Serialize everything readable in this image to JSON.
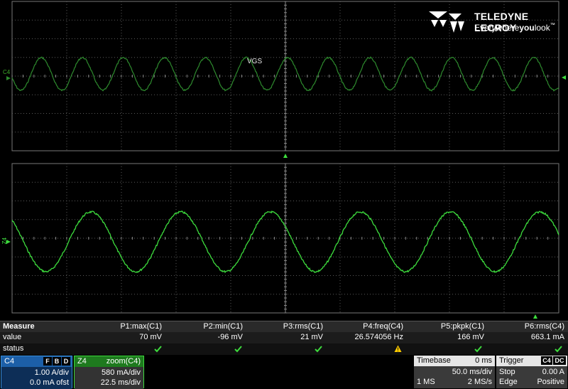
{
  "brand": {
    "name": "TELEDYNE LECROY",
    "tagline_prefix": "Everywhere",
    "tagline_bold": "you",
    "tagline_suffix": "look",
    "tm": "™"
  },
  "screen": {
    "channel_top": "C4",
    "channel_bottom": "Z4",
    "trace_label": "VGS",
    "colors": {
      "c4": "#2e8b2e",
      "z4": "#3ddc3d",
      "grid": "#5a5a5a"
    }
  },
  "measure": {
    "row_labels": {
      "header": "Measure",
      "value": "value",
      "status": "status"
    },
    "params": [
      {
        "name": "P1:max(C1)",
        "value": "70 mV",
        "status": "ok"
      },
      {
        "name": "P2:min(C1)",
        "value": "-96 mV",
        "status": "ok"
      },
      {
        "name": "P3:rms(C1)",
        "value": "21 mV",
        "status": "ok"
      },
      {
        "name": "P4:freq(C4)",
        "value": "26.574056 Hz",
        "status": "warning"
      },
      {
        "name": "P5:pkpk(C1)",
        "value": "166 mV",
        "status": "ok"
      },
      {
        "name": "P6:rms(C4)",
        "value": "663.1 mA",
        "status": "ok"
      }
    ]
  },
  "c4_box": {
    "label": "C4",
    "flags": [
      "F",
      "B",
      "D"
    ],
    "scale": "1.00 A/div",
    "offset": "0.0 mA ofst"
  },
  "z4_box": {
    "label": "Z4",
    "source": "zoom(C4)",
    "scale": "580 mA/div",
    "time": "22.5 ms/div"
  },
  "timebase": {
    "label": "Timebase",
    "delay": "0 ms",
    "tdiv": "50.0 ms/div",
    "points": "1 MS",
    "rate": "2 MS/s"
  },
  "trigger": {
    "label": "Trigger",
    "source": "C4",
    "coupling": "DC",
    "mode": "Stop",
    "level": "0.00 A",
    "type": "Edge",
    "slope": "Positive"
  }
}
